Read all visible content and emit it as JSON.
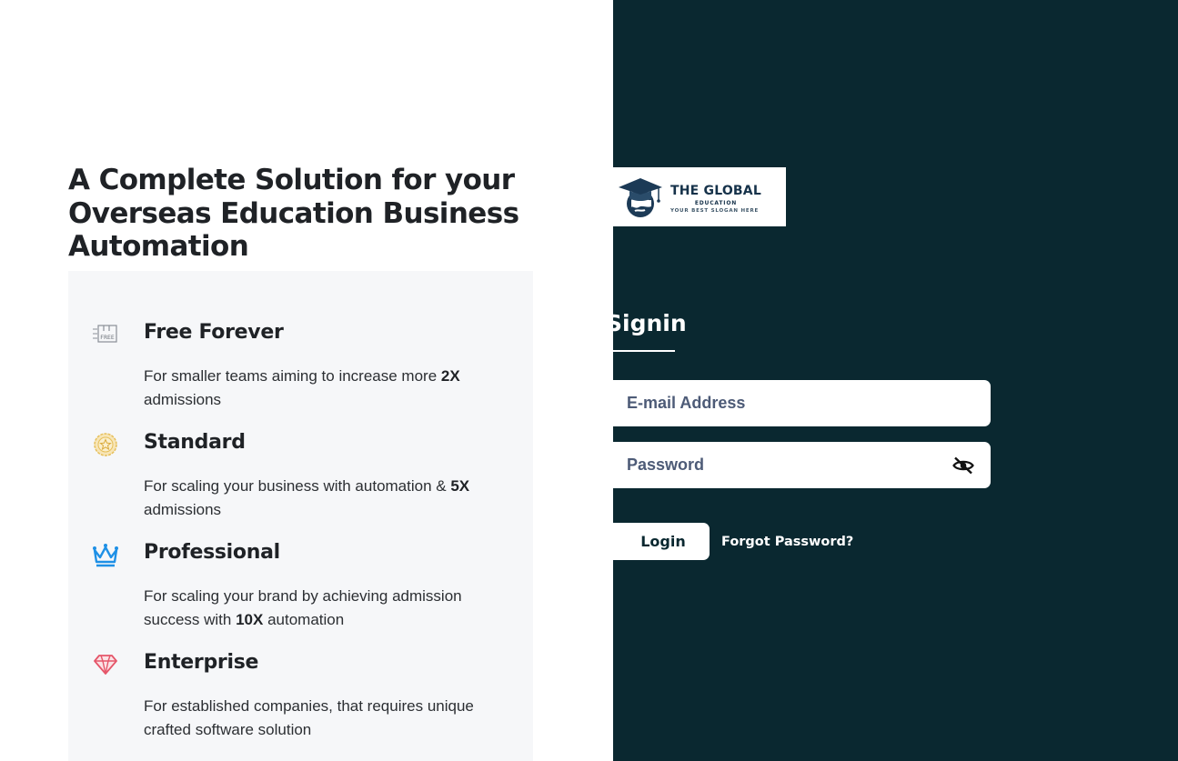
{
  "hero": {
    "headline": "A Complete Solution for your Overseas Education Business Automation"
  },
  "plans": [
    {
      "icon": "free-tag-icon",
      "title": "Free Forever",
      "desc_before": "For smaller teams aiming to increase more ",
      "desc_bold": "2X",
      "desc_after": " admissions"
    },
    {
      "icon": "gold-badge-icon",
      "title": "Standard",
      "desc_before": "For scaling your business with automation & ",
      "desc_bold": "5X",
      "desc_after": " admissions"
    },
    {
      "icon": "crown-icon",
      "title": "Professional",
      "desc_before": "For scaling your brand by achieving admission success with ",
      "desc_bold": "10X",
      "desc_after": " automation"
    },
    {
      "icon": "diamond-icon",
      "title": "Enterprise",
      "desc_before": "For established companies, that requires unique crafted software solution",
      "desc_bold": "",
      "desc_after": ""
    }
  ],
  "logo": {
    "main": "THE GLOBAL",
    "sub": "EDUCATION",
    "slogan": "YOUR BEST SLOGAN HERE"
  },
  "signin": {
    "title": "Signin",
    "email_placeholder": "E-mail Address",
    "password_placeholder": "Password",
    "login_label": "Login",
    "forgot_label": "Forgot Password?"
  },
  "colors": {
    "right_panel_bg": "#0a2830",
    "plans_bg": "#f6f7f9",
    "heading_text": "#1f2226",
    "input_text": "#4d5b77"
  }
}
